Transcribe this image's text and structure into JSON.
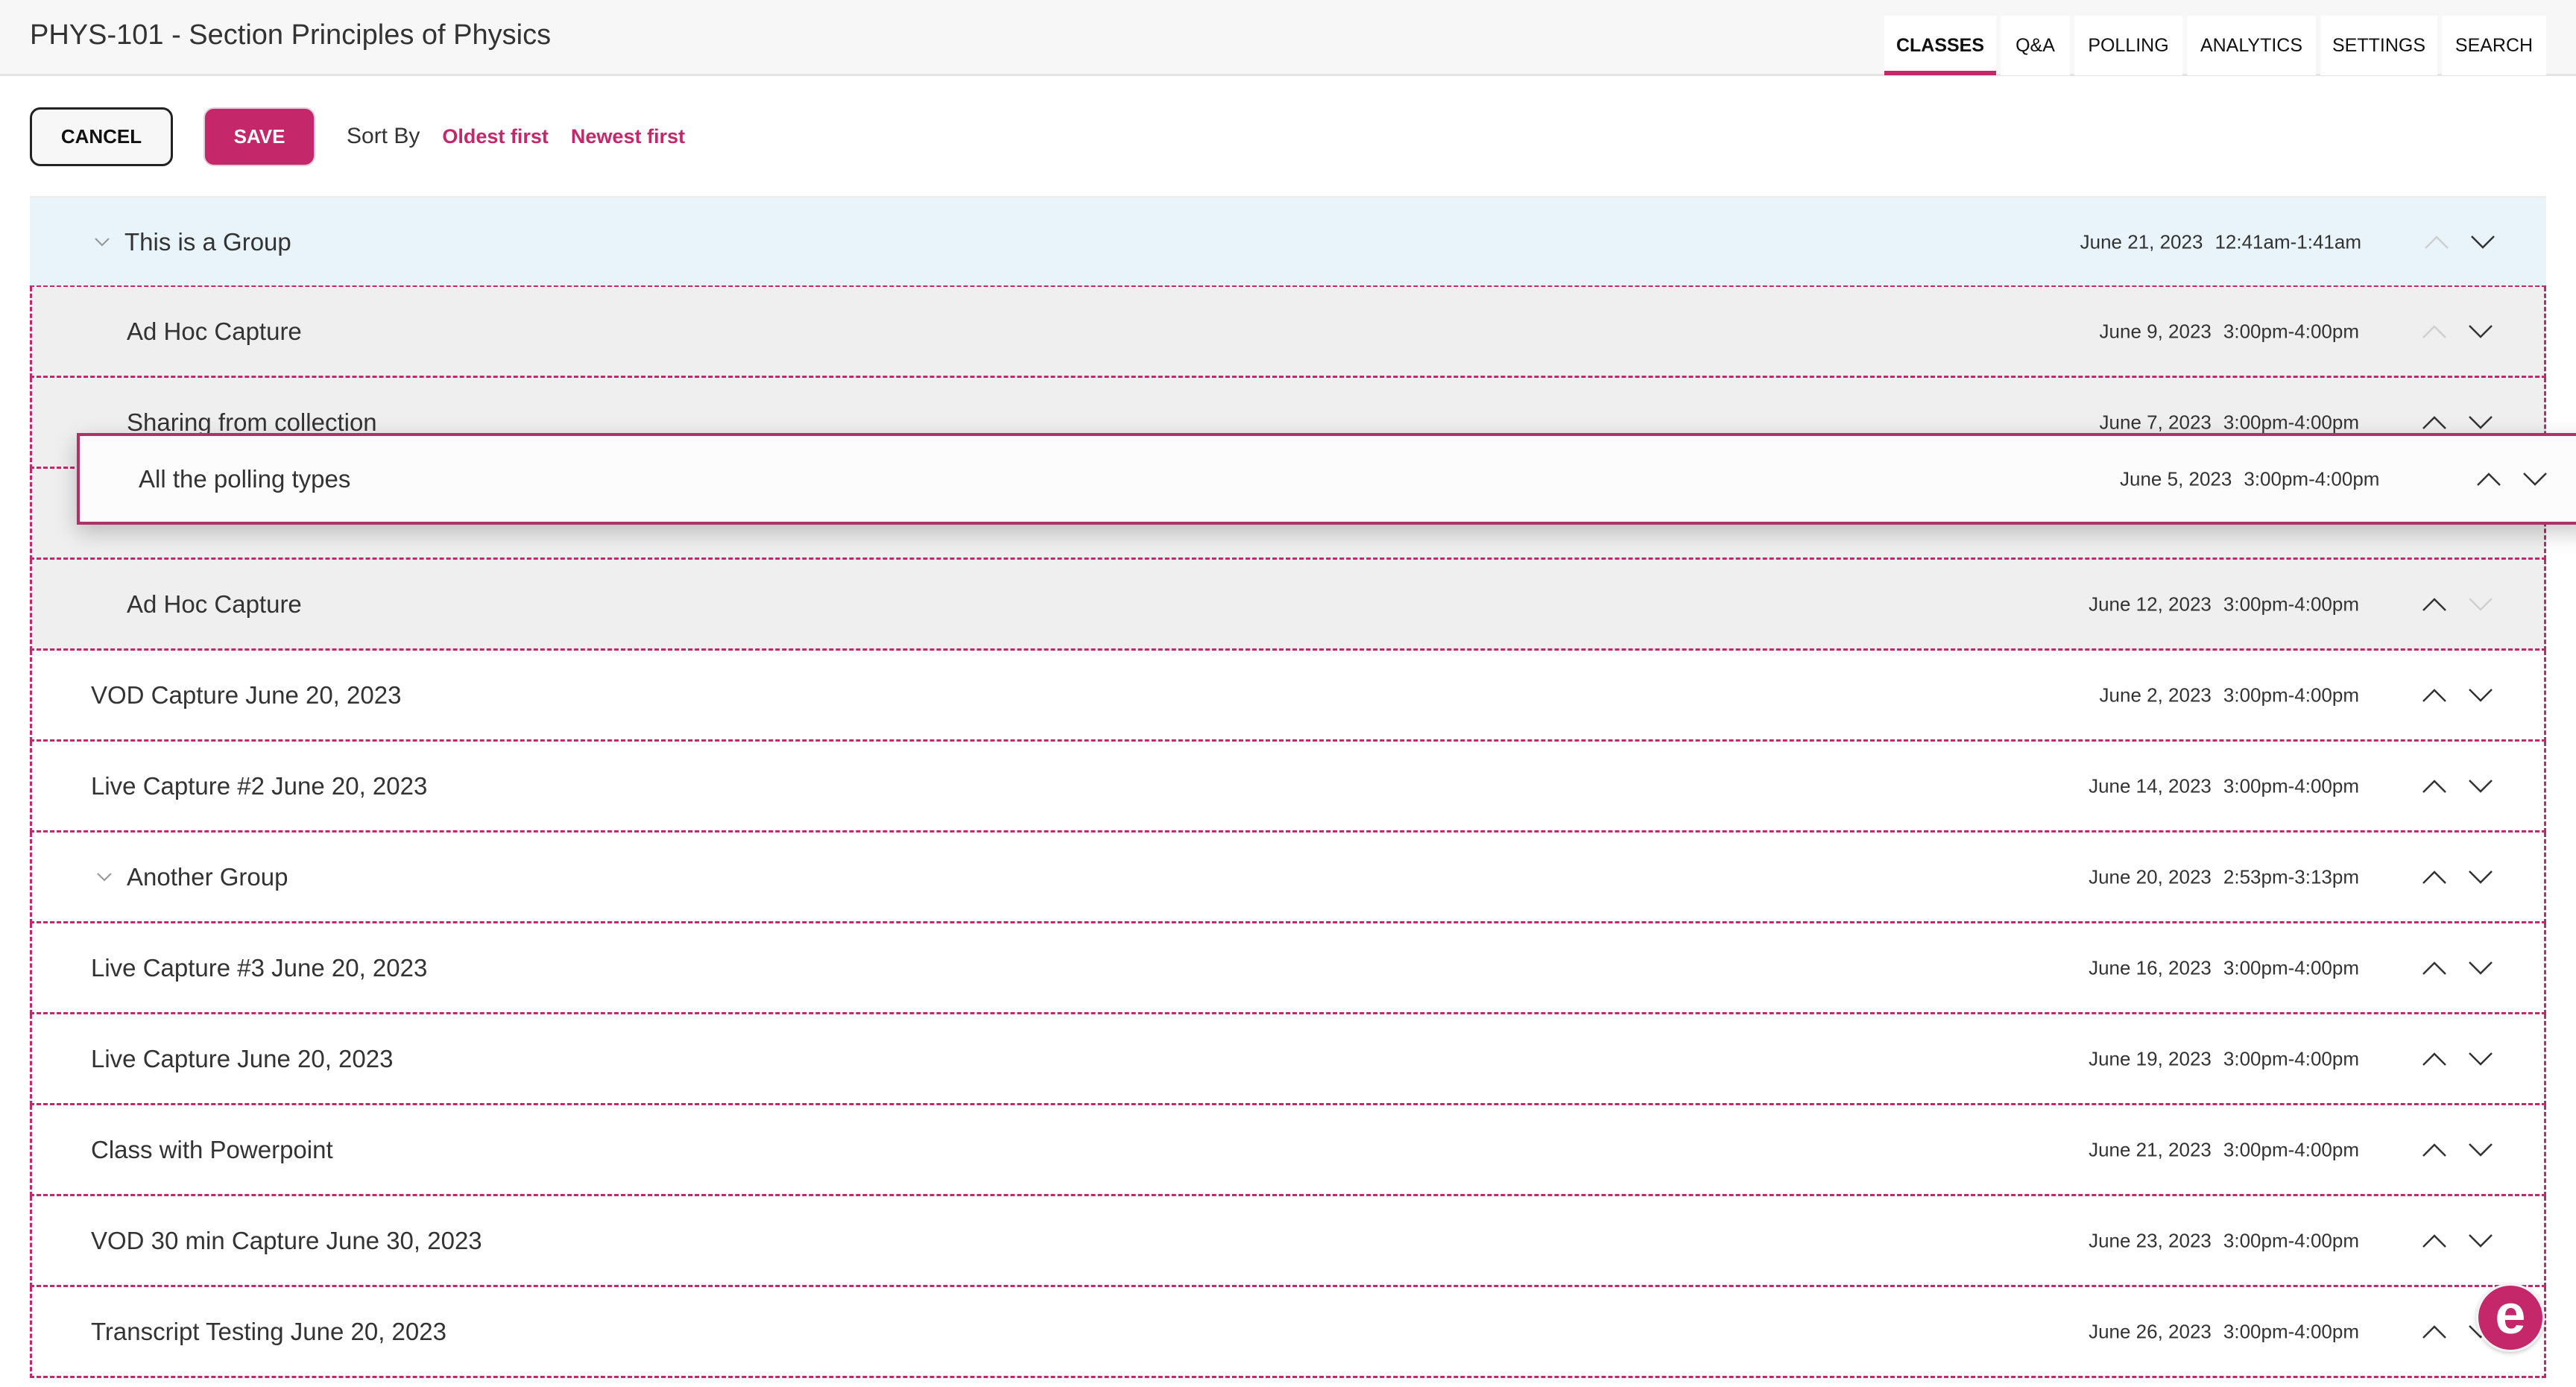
{
  "header": {
    "title": "PHYS-101 - Section Principles of Physics",
    "tabs": [
      {
        "label": "CLASSES",
        "active": true
      },
      {
        "label": "Q&A",
        "active": false
      },
      {
        "label": "POLLING",
        "active": false
      },
      {
        "label": "ANALYTICS",
        "active": false
      },
      {
        "label": "SETTINGS",
        "active": false
      },
      {
        "label": "SEARCH",
        "active": false
      }
    ]
  },
  "toolbar": {
    "cancel_label": "CANCEL",
    "save_label": "SAVE",
    "sort_label": "Sort By",
    "sort_oldest": "Oldest first",
    "sort_newest": "Newest first"
  },
  "colors": {
    "accent": "#c4286a",
    "group_bg": "#e8f4fa",
    "child_bg": "#efefef"
  },
  "rows": [
    {
      "title": "This is a Group",
      "date": "June 21, 2023",
      "time": "12:41am-1:41am",
      "type": "group",
      "up_enabled": false,
      "down_enabled": true
    },
    {
      "title": "Ad Hoc Capture",
      "date": "June 9, 2023",
      "time": "3:00pm-4:00pm",
      "type": "child",
      "up_enabled": false,
      "down_enabled": true
    },
    {
      "title": "Sharing from collection",
      "date": "June 7, 2023",
      "time": "3:00pm-4:00pm",
      "type": "child",
      "up_enabled": true,
      "down_enabled": true
    },
    {
      "title": "",
      "date": "",
      "time": "",
      "type": "placeholder"
    },
    {
      "title": "Ad Hoc Capture",
      "date": "June 12, 2023",
      "time": "3:00pm-4:00pm",
      "type": "child",
      "up_enabled": true,
      "down_enabled": false
    },
    {
      "title": "VOD Capture June 20, 2023",
      "date": "June 2, 2023",
      "time": "3:00pm-4:00pm",
      "type": "class",
      "up_enabled": true,
      "down_enabled": true
    },
    {
      "title": "Live Capture #2 June 20, 2023",
      "date": "June 14, 2023",
      "time": "3:00pm-4:00pm",
      "type": "class",
      "up_enabled": true,
      "down_enabled": true
    },
    {
      "title": "Another Group",
      "date": "June 20, 2023",
      "time": "2:53pm-3:13pm",
      "type": "group-collapsed",
      "up_enabled": true,
      "down_enabled": true
    },
    {
      "title": "Live Capture #3 June 20, 2023",
      "date": "June 16, 2023",
      "time": "3:00pm-4:00pm",
      "type": "class",
      "up_enabled": true,
      "down_enabled": true
    },
    {
      "title": "Live Capture June 20, 2023",
      "date": "June 19, 2023",
      "time": "3:00pm-4:00pm",
      "type": "class",
      "up_enabled": true,
      "down_enabled": true
    },
    {
      "title": "Class with Powerpoint",
      "date": "June 21, 2023",
      "time": "3:00pm-4:00pm",
      "type": "class",
      "up_enabled": true,
      "down_enabled": true
    },
    {
      "title": "VOD 30 min Capture June 30, 2023",
      "date": "June 23, 2023",
      "time": "3:00pm-4:00pm",
      "type": "class",
      "up_enabled": true,
      "down_enabled": true
    },
    {
      "title": "Transcript Testing June 20, 2023",
      "date": "June 26, 2023",
      "time": "3:00pm-4:00pm",
      "type": "class",
      "up_enabled": true,
      "down_enabled": true
    }
  ],
  "dragging_item": {
    "title": "All the polling types",
    "date": "June 5, 2023",
    "time": "3:00pm-4:00pm"
  },
  "fab": {
    "label": "e",
    "icon": "echo-logo-icon"
  }
}
